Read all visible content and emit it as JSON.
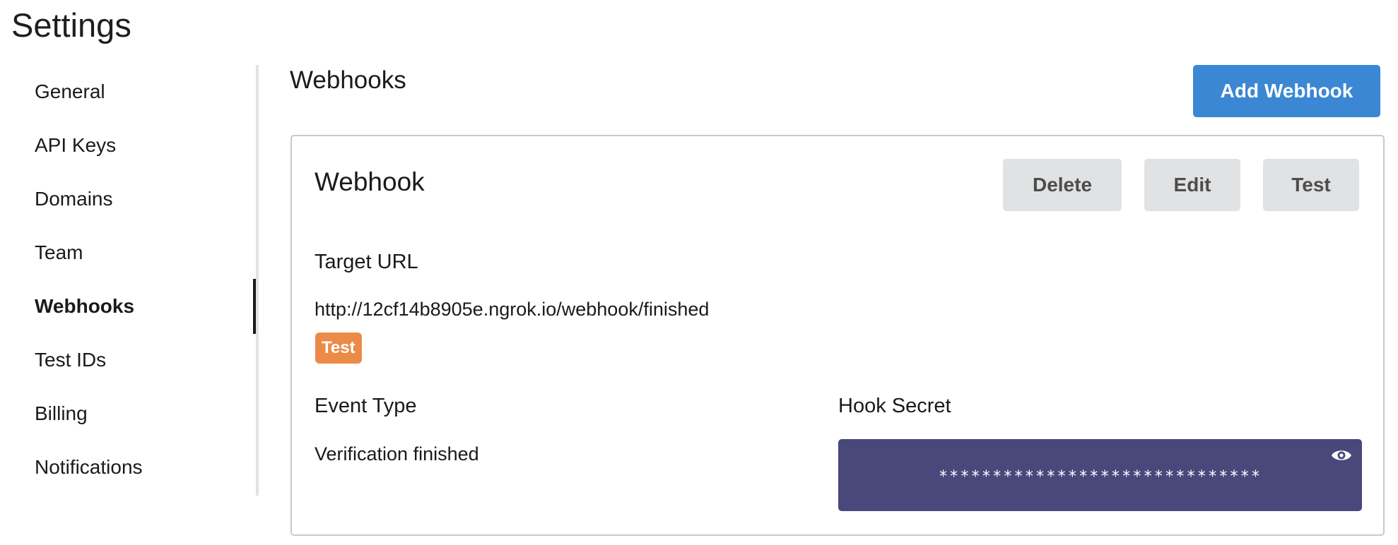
{
  "page": {
    "title": "Settings"
  },
  "sidebar": {
    "items": [
      {
        "label": "General"
      },
      {
        "label": "API Keys"
      },
      {
        "label": "Domains"
      },
      {
        "label": "Team"
      },
      {
        "label": "Webhooks"
      },
      {
        "label": "Test IDs"
      },
      {
        "label": "Billing"
      },
      {
        "label": "Notifications"
      }
    ],
    "active_item": "Webhooks"
  },
  "webhooks": {
    "section_title": "Webhooks",
    "add_label": "Add Webhook",
    "card": {
      "title": "Webhook",
      "delete_label": "Delete",
      "edit_label": "Edit",
      "test_label": "Test",
      "target_url_label": "Target URL",
      "target_url": "http://12cf14b8905e.ngrok.io/webhook/finished",
      "badge": "Test",
      "event_type_label": "Event Type",
      "event_type": "Verification finished",
      "hook_secret_label": "Hook Secret",
      "hook_secret_masked": "******************************"
    }
  },
  "colors": {
    "primary_button": "#3b87d3",
    "test_badge": "#ec8a47",
    "secret_background": "#48487b",
    "secondary_button": "#e1e2e3"
  },
  "icons": {
    "reveal_secret": "eye-icon"
  }
}
